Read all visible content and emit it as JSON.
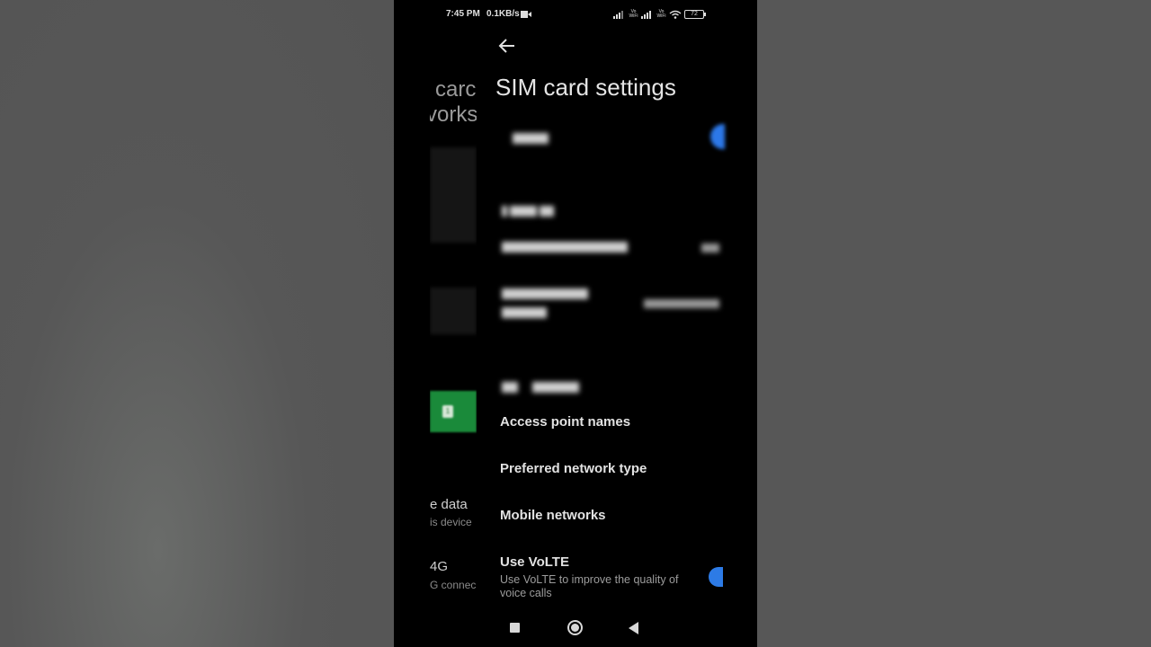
{
  "status_bar": {
    "time": "7:45 PM",
    "network_speed": "0.1KB/s",
    "volte_wifi_label_1": "Vo WiFi",
    "volte_wifi_label_2": "Vo WiFi",
    "battery": "72"
  },
  "previous_screen": {
    "title_line_1": "carc",
    "title_line_2": "vorks",
    "sim_slot": "1",
    "label_data": "e data",
    "sub_data": "is device",
    "label_4g": "4G",
    "sub_4g": "G connec"
  },
  "header": {
    "title": "SIM card settings"
  },
  "menu": {
    "access_point_names": "Access point names",
    "preferred_network_type": "Preferred network type",
    "mobile_networks": "Mobile networks",
    "use_volte": {
      "title": "Use VoLTE",
      "subtitle": "Use VoLTE to improve the quality of voice calls",
      "enabled": true
    }
  },
  "colors": {
    "toggle_on": "#2d7be6",
    "sim_green": "#1a8a3a"
  },
  "icons": {
    "back": "back-arrow-icon",
    "recent": "recent-apps-icon",
    "home": "home-icon",
    "nav_back": "nav-back-icon"
  }
}
